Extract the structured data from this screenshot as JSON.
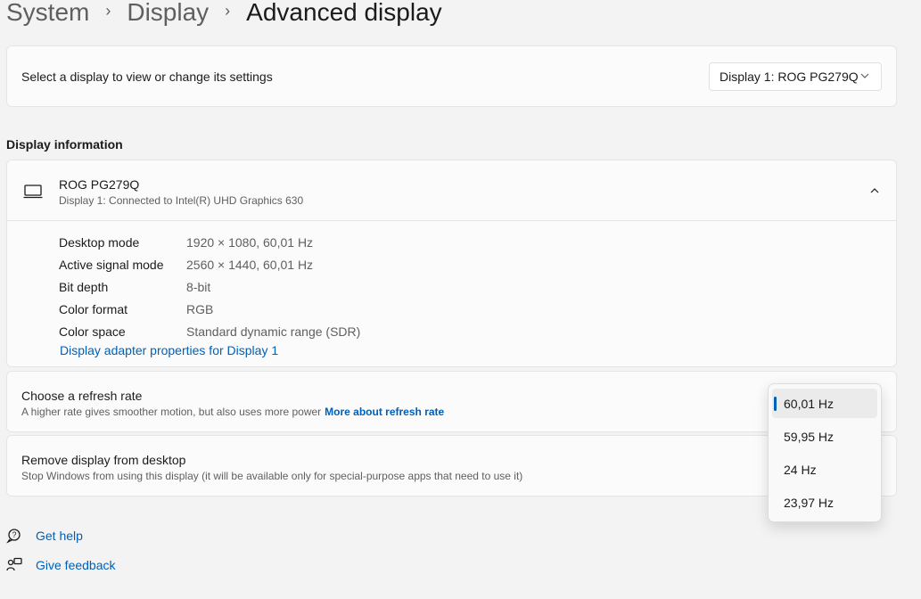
{
  "breadcrumb": {
    "items": [
      "System",
      "Display",
      "Advanced display"
    ]
  },
  "select_display": {
    "label": "Select a display to view or change its settings",
    "value": "Display 1: ROG PG279Q"
  },
  "display_info": {
    "section_title": "Display information",
    "name": "ROG PG279Q",
    "subtitle": "Display 1: Connected to Intel(R) UHD Graphics 630",
    "rows": [
      {
        "key": "Desktop mode",
        "value": "1920 × 1080, 60,01 Hz"
      },
      {
        "key": "Active signal mode",
        "value": "2560 × 1440, 60,01 Hz"
      },
      {
        "key": "Bit depth",
        "value": "8-bit"
      },
      {
        "key": "Color format",
        "value": "RGB"
      },
      {
        "key": "Color space",
        "value": "Standard dynamic range (SDR)"
      }
    ],
    "adapter_link": "Display adapter properties for Display 1"
  },
  "refresh_rate": {
    "title": "Choose a refresh rate",
    "subtitle": "A higher rate gives smoother motion, but also uses more power",
    "link": "More about refresh rate",
    "options": [
      "60,01 Hz",
      "59,95 Hz",
      "24 Hz",
      "23,97 Hz"
    ],
    "selected": "60,01 Hz"
  },
  "remove_display": {
    "title": "Remove display from desktop",
    "subtitle": "Stop Windows from using this display (it will be available only for special-purpose apps that need to use it)"
  },
  "footer": {
    "get_help": "Get help",
    "give_feedback": "Give feedback"
  },
  "colors": {
    "accent": "#005fb8",
    "background": "#f3f3f3",
    "card": "#fbfbfb"
  }
}
